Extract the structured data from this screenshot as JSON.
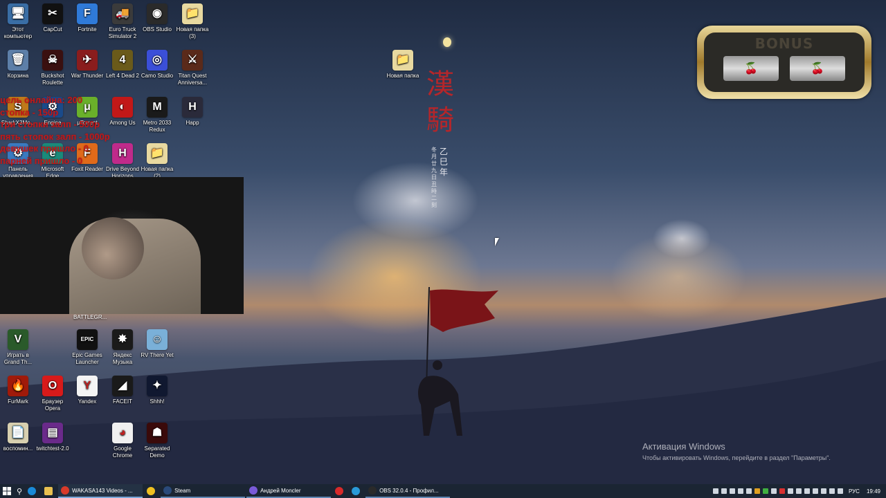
{
  "wallpaper": {
    "kanji_large": "漢騎",
    "kanji_small": "乙巳年",
    "kanji_tiny": "冬月廿九日丑時二刻"
  },
  "desktop_icons": [
    {
      "label": "Этот компьютер",
      "glyph": "🖥",
      "bg": "#3a6ea5"
    },
    {
      "label": "CapCut",
      "glyph": "✂",
      "bg": "#111111"
    },
    {
      "label": "Fortnite",
      "glyph": "F",
      "bg": "#2f7ad8"
    },
    {
      "label": "Euro Truck Simulator 2",
      "glyph": "🚚",
      "bg": "#3b3b3b"
    },
    {
      "label": "OBS Studio",
      "glyph": "◉",
      "bg": "#2a2a2a"
    },
    {
      "label": "Новая папка (3)",
      "glyph": "📁",
      "bg": "#e8d9a0"
    },
    {
      "label": "Корзина",
      "glyph": "🗑",
      "bg": "#5d7fa8"
    },
    {
      "label": "Buckshot Roulette",
      "glyph": "☠",
      "bg": "#3a1010"
    },
    {
      "label": "War Thunder",
      "glyph": "✈",
      "bg": "#8a1d1d"
    },
    {
      "label": "Left 4 Dead 2",
      "glyph": "4",
      "bg": "#6a5a1a"
    },
    {
      "label": "Camo Studio",
      "glyph": "◎",
      "bg": "#3b4fd8"
    },
    {
      "label": "Titan Quest Anniversa...",
      "glyph": "⚔",
      "bg": "#5a2a1a"
    },
    {
      "label": "SharkX3Mo...",
      "glyph": "S",
      "bg": "#c07a1a"
    },
    {
      "label": "Engine",
      "glyph": "⚙",
      "bg": "#1a4a8a"
    },
    {
      "label": "μTorrent",
      "glyph": "μ",
      "bg": "#6ab02a"
    },
    {
      "label": "Among Us",
      "glyph": "◐",
      "bg": "#c21818"
    },
    {
      "label": "Metro 2033 Redux",
      "glyph": "M",
      "bg": "#1a1a1a"
    },
    {
      "label": "Happ",
      "glyph": "H",
      "bg": "#2a2a3a"
    },
    {
      "label": "Панель управления",
      "glyph": "⚙",
      "bg": "#3a7ac0"
    },
    {
      "label": "Microsoft Edge",
      "glyph": "e",
      "bg": "#1a8a7a"
    },
    {
      "label": "Foxit Reader",
      "glyph": "F",
      "bg": "#e06a1a"
    },
    {
      "label": "Drive Beyond Horizons",
      "glyph": "H",
      "bg": "#c02a8a"
    },
    {
      "label": "Новая папка (2)",
      "glyph": "📁",
      "bg": "#e8d9a0"
    },
    {
      "label": "Играть в Grand Th...",
      "glyph": "V",
      "bg": "#2a5a2a"
    },
    {
      "label": "Epic Games Launcher",
      "glyph": "EPIC",
      "bg": "#111111"
    },
    {
      "label": "Яндекс Музыка",
      "glyph": "✸",
      "bg": "#1a1a1a"
    },
    {
      "label": "RV There Yet",
      "glyph": "☺",
      "bg": "#7ab0d8"
    },
    {
      "label": "FurMark",
      "glyph": "🔥",
      "bg": "#a01a0a"
    },
    {
      "label": "Браузер Opera",
      "glyph": "O",
      "bg": "#d81a1a"
    },
    {
      "label": "Yandex",
      "glyph": "Y",
      "bg": "#f4f4f4"
    },
    {
      "label": "FACEIT",
      "glyph": "◢",
      "bg": "#1a1a1a"
    },
    {
      "label": "Shhh!",
      "glyph": "✦",
      "bg": "#101830"
    },
    {
      "label": "воспомин...",
      "glyph": "📄",
      "bg": "#d8d0b0"
    },
    {
      "label": "twitchtest-2.0",
      "glyph": "▤",
      "bg": "#6a2a8a"
    },
    {
      "label": "Google Chrome",
      "glyph": "◕",
      "bg": "#f0f0f0"
    },
    {
      "label": "Separated Demo",
      "glyph": "☗",
      "bg": "#3a0a0a"
    },
    {
      "label": "Новая папка",
      "glyph": "📁",
      "bg": "#e8d9a0"
    }
  ],
  "overlay": {
    "lines": [
      "цель онлайна: 200",
      "стопка - 150р",
      "три стопки залп - 500р",
      "пять стопок залп - 1000р",
      "девушек пришло - 0",
      "парней пришло - 0"
    ]
  },
  "webcam_label": "BATTLEGR...",
  "bonus_widget": {
    "title": "BONUS",
    "slot1": "🍒",
    "slot2": "🍒"
  },
  "activation": {
    "title": "Активация Windows",
    "subtitle": "Чтобы активировать Windows, перейдите в раздел \"Параметры\"."
  },
  "taskbar": {
    "apps": [
      {
        "label": "WAKASA143 Videos - ...",
        "color": "#d83a2a"
      },
      {
        "label": "",
        "color": "#f0c020"
      },
      {
        "label": "Steam",
        "color": "#2a4a7a"
      },
      {
        "label": "Андрей Moncler",
        "color": "#7a5ad8"
      },
      {
        "label": "",
        "color": "#d82a2a"
      },
      {
        "label": "",
        "color": "#2a9ad8"
      },
      {
        "label": "OBS 32.0.4 - Профил...",
        "color": "#2a2a2a"
      }
    ],
    "lang": "РУС",
    "time": "19:49"
  }
}
